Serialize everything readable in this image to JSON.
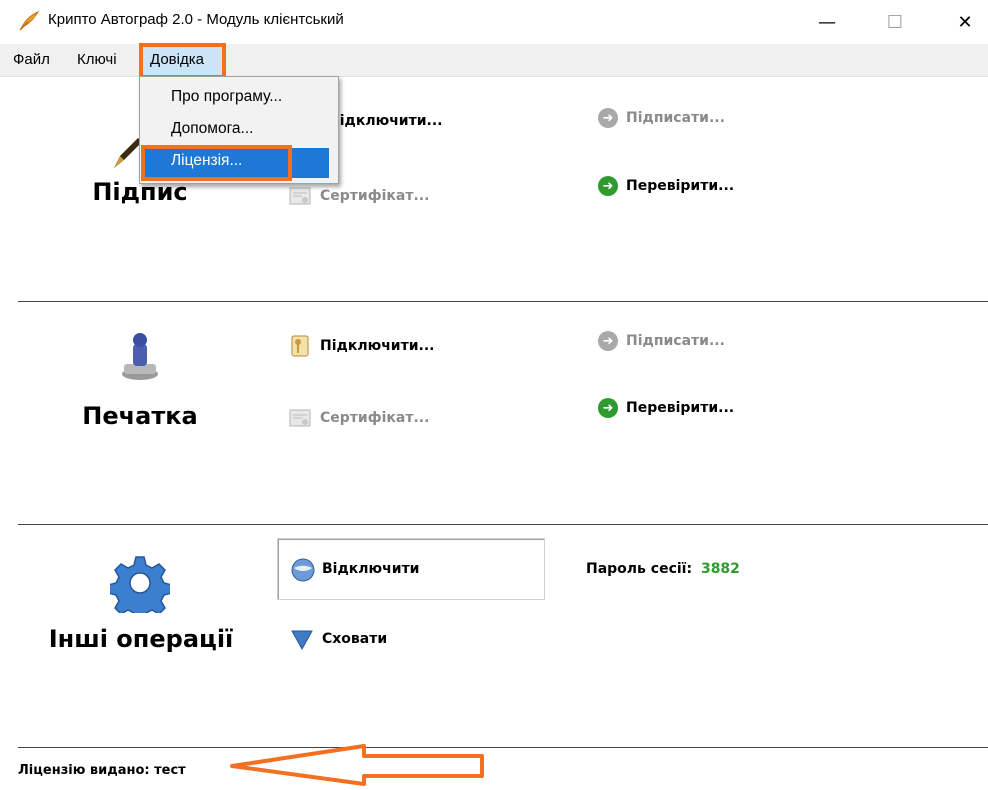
{
  "window": {
    "title": "Крипто Автограф 2.0 - Модуль клієнтський",
    "min": "—",
    "max": "☐",
    "close": "✕"
  },
  "menu": {
    "file": "Файл",
    "keys": "Ключі",
    "help": "Довідка"
  },
  "dropdown": {
    "about": "Про програму...",
    "help": "Допомога...",
    "license": "Ліцензія..."
  },
  "signature": {
    "label": "Підпис",
    "connect": "Підключити...",
    "certificate": "Сертифікат...",
    "sign": "Підписати...",
    "verify": "Перевірити..."
  },
  "stamp": {
    "label": "Печатка",
    "connect": "Підключити...",
    "certificate": "Сертифікат...",
    "sign": "Підписати...",
    "verify": "Перевірити..."
  },
  "other": {
    "label": "Інші операції",
    "disconnect": "Відключити",
    "hide": "Сховати",
    "session_label": "Пароль сесії:",
    "session_value": "3882"
  },
  "status": {
    "text": "Ліцензію видано: тест"
  },
  "colors": {
    "highlight": "#f37021",
    "menu_selection": "#1e79d6",
    "session_value": "#2f9a2f"
  }
}
